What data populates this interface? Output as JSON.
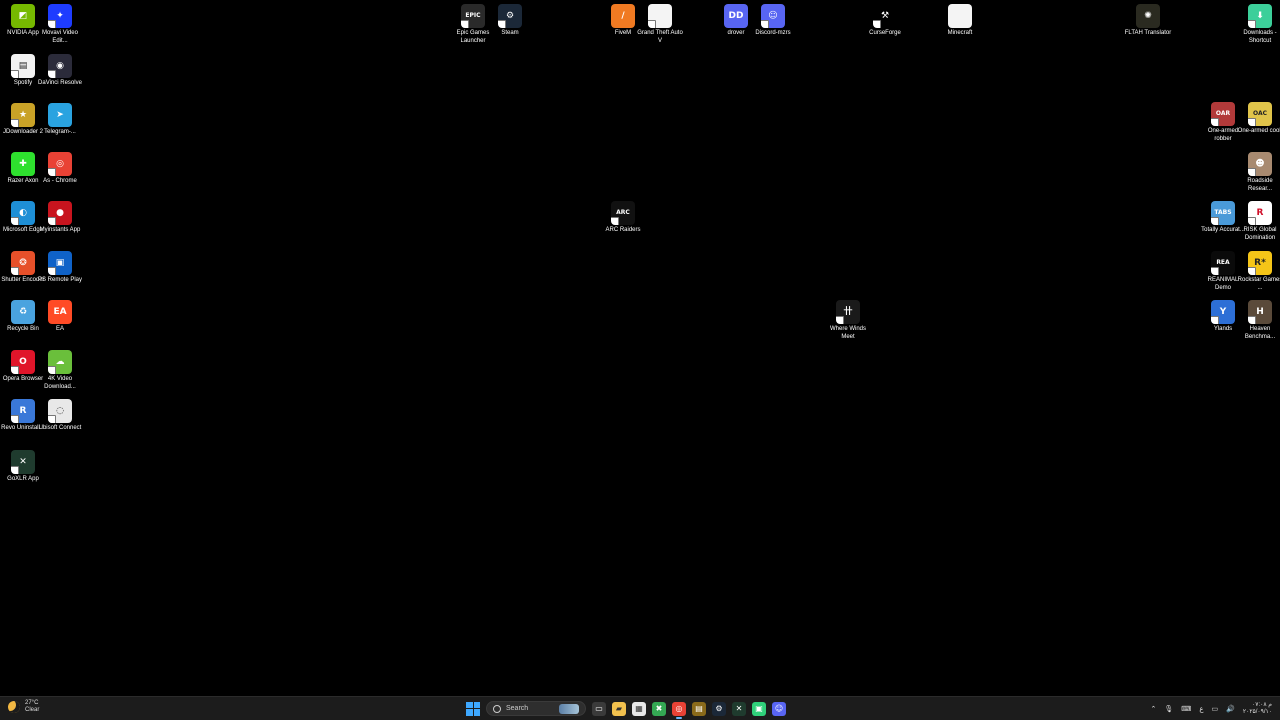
{
  "desktop_icons": [
    {
      "label": "NVIDIA App",
      "color": "#76b900",
      "glyph": "◩",
      "shortcut": false,
      "icon": "nvidia-icon"
    },
    {
      "label": "Movavi Video Edit...",
      "color": "#1e3cff",
      "glyph": "✦",
      "shortcut": true,
      "icon": "movavi-icon"
    },
    {
      "label": "Spotify",
      "color": "#f2f2f2",
      "glyph": "▤",
      "shortcut": true,
      "icon": "document-icon"
    },
    {
      "label": "DaVinci Resolve",
      "color": "#2b2b3a",
      "glyph": "◉",
      "shortcut": true,
      "icon": "davinci-resolve-icon"
    },
    {
      "label": "JDownloader 2",
      "color": "#c9a227",
      "glyph": "★",
      "shortcut": true,
      "icon": "jdownloader-icon"
    },
    {
      "label": "Telegram-...",
      "color": "#2aa3e0",
      "glyph": "➤",
      "shortcut": false,
      "icon": "telegram-icon"
    },
    {
      "label": "Razer Axon",
      "color": "#2ee02e",
      "glyph": "✚",
      "shortcut": false,
      "icon": "razer-axon-icon"
    },
    {
      "label": "As - Chrome",
      "color": "#e94235",
      "glyph": "◎",
      "shortcut": true,
      "icon": "chrome-icon"
    },
    {
      "label": "Microsoft Edge",
      "color": "#1e8fd6",
      "glyph": "◐",
      "shortcut": true,
      "icon": "edge-icon"
    },
    {
      "label": "Myinstants App",
      "color": "#c8141e",
      "glyph": "●",
      "shortcut": true,
      "icon": "myinstants-icon"
    },
    {
      "label": "Shutter Encoder",
      "color": "#e6502a",
      "glyph": "❂",
      "shortcut": true,
      "icon": "shutter-encoder-icon"
    },
    {
      "label": "PS Remote Play",
      "color": "#0f62c8",
      "glyph": "▣",
      "shortcut": true,
      "icon": "ps-remote-play-icon"
    },
    {
      "label": "Recycle Bin",
      "color": "#4aa3df",
      "glyph": "♻",
      "shortcut": false,
      "icon": "recycle-bin-icon"
    },
    {
      "label": "EA",
      "color": "#ff4b26",
      "glyph": "EA",
      "shortcut": false,
      "icon": "ea-icon"
    },
    {
      "label": "Opera Browser",
      "color": "#e0152a",
      "glyph": "O",
      "shortcut": true,
      "icon": "opera-icon"
    },
    {
      "label": "4K Video Download...",
      "color": "#6abf3b",
      "glyph": "☁",
      "shortcut": true,
      "icon": "4k-video-downloader-icon"
    },
    {
      "label": "Revo Uninstall...",
      "color": "#3a78d8",
      "glyph": "R",
      "shortcut": true,
      "icon": "revo-uninstaller-icon"
    },
    {
      "label": "Ubisoft Connect",
      "color": "#e8e8e8",
      "glyph": "◌",
      "shortcut": true,
      "icon": "ubisoft-connect-icon"
    },
    {
      "label": "GoXLR App",
      "color": "#1f3b2e",
      "glyph": "✕",
      "shortcut": true,
      "icon": "goxlr-icon"
    },
    {
      "label": "Epic Games Launcher",
      "color": "#2a2a2a",
      "glyph": "EPIC",
      "shortcut": true,
      "icon": "epic-games-icon"
    },
    {
      "label": "Steam",
      "color": "#1b2838",
      "glyph": "⚙",
      "shortcut": true,
      "icon": "steam-icon"
    },
    {
      "label": "FiveM",
      "color": "#f07a22",
      "glyph": "/",
      "shortcut": false,
      "icon": "fivem-icon"
    },
    {
      "label": "Grand Theft Auto V",
      "color": "#f4f4f4",
      "glyph": "",
      "shortcut": true,
      "icon": "document-icon"
    },
    {
      "label": "drover",
      "color": "#5865f2",
      "glyph": "DD",
      "shortcut": false,
      "icon": "drover-icon"
    },
    {
      "label": "Discord-mzrs",
      "color": "#5865f2",
      "glyph": "☺",
      "shortcut": true,
      "icon": "discord-icon"
    },
    {
      "label": "CurseForge",
      "color": "#000000",
      "glyph": "⚒",
      "shortcut": true,
      "icon": "curseforge-icon"
    },
    {
      "label": "Minecraft",
      "color": "#f4f4f4",
      "glyph": "",
      "shortcut": false,
      "icon": "document-icon"
    },
    {
      "label": "FLTAH Translator",
      "color": "#2a2a20",
      "glyph": "✺",
      "shortcut": false,
      "icon": "fltah-translator-icon"
    },
    {
      "label": "Downloads - Shortcut",
      "color": "#3ccf9a",
      "glyph": "⬇",
      "shortcut": true,
      "icon": "downloads-folder-icon"
    },
    {
      "label": "One-armed robber",
      "color": "#b23a3a",
      "glyph": "OAR",
      "shortcut": true,
      "icon": "one-armed-robber-icon"
    },
    {
      "label": "One-armed cook",
      "color": "#e0c44a",
      "glyph": "OAC",
      "shortcut": true,
      "icon": "one-armed-cook-icon"
    },
    {
      "label": "Roadside Resear...",
      "color": "#a88a70",
      "glyph": "☻",
      "shortcut": true,
      "icon": "roadside-research-icon"
    },
    {
      "label": "ARC Raiders",
      "color": "#111111",
      "glyph": "ARC",
      "shortcut": true,
      "icon": "arc-raiders-icon"
    },
    {
      "label": "Where Winds Meet",
      "color": "#1a1a1a",
      "glyph": "卄",
      "shortcut": true,
      "icon": "where-winds-meet-icon"
    },
    {
      "label": "Totally Accurat...",
      "color": "#4a9ad8",
      "glyph": "TABS",
      "shortcut": true,
      "icon": "tabs-icon"
    },
    {
      "label": "RISK Global Domination",
      "color": "#ffffff",
      "glyph": "R",
      "shortcut": true,
      "icon": "risk-icon"
    },
    {
      "label": "REANIMAL Demo",
      "color": "#0a0a0a",
      "glyph": "REA",
      "shortcut": true,
      "icon": "reanimal-icon"
    },
    {
      "label": "Rockstar Games ...",
      "color": "#f5c518",
      "glyph": "R*",
      "shortcut": true,
      "icon": "rockstar-icon"
    },
    {
      "label": "Ylands",
      "color": "#2d6fd6",
      "glyph": "Y",
      "shortcut": true,
      "icon": "ylands-icon"
    },
    {
      "label": "Heaven Benchma...",
      "color": "#5a4a3a",
      "glyph": "H",
      "shortcut": true,
      "icon": "heaven-benchmark-icon"
    }
  ],
  "taskbar": {
    "weather": {
      "temp": "27°C",
      "condition": "Clear"
    },
    "search_label": "Search",
    "apps": [
      {
        "name": "task-view",
        "glyph": "▭",
        "color": "#3a3a3a"
      },
      {
        "name": "file-explorer",
        "glyph": "▰",
        "color": "#f2c14e"
      },
      {
        "name": "microsoft-store",
        "glyph": "▦",
        "color": "#e8e8e8"
      },
      {
        "name": "xbox",
        "glyph": "✖",
        "color": "#34a853"
      },
      {
        "name": "chrome",
        "glyph": "◎",
        "color": "#e94235"
      },
      {
        "name": "app-gold",
        "glyph": "▤",
        "color": "#8a6a1a"
      },
      {
        "name": "steam",
        "glyph": "⚙",
        "color": "#1b2838"
      },
      {
        "name": "goxlr",
        "glyph": "✕",
        "color": "#1f3b2e"
      },
      {
        "name": "app-green",
        "glyph": "▣",
        "color": "#2fd07a"
      },
      {
        "name": "discord",
        "glyph": "☺",
        "color": "#5865f2"
      }
    ],
    "tray_lang": "ع",
    "clock_time": "۰۷:۰۸ م",
    "clock_date": "۲۰۲۵/۰۹/۱۰"
  }
}
